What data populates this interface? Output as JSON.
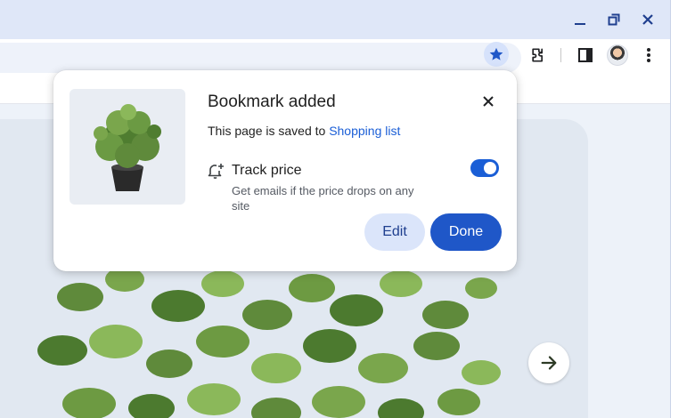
{
  "window": {
    "controls": {
      "minimize_icon": "minimize-icon",
      "restore_icon": "restore-icon",
      "close_icon": "close-icon"
    }
  },
  "toolbar": {
    "bookmark_star": {
      "state": "bookmarked",
      "icon": "star-icon"
    },
    "icons": [
      "extensions-icon",
      "side-panel-icon",
      "profile-avatar",
      "more-menu-icon"
    ]
  },
  "bubble": {
    "title": "Bookmark added",
    "saved_prefix": "This page is saved to ",
    "saved_folder": "Shopping list",
    "track": {
      "title": "Track price",
      "description": "Get emails if the price drops on any site",
      "enabled": true
    },
    "edit_label": "Edit",
    "done_label": "Done"
  },
  "page": {
    "next_icon": "arrow-right-icon"
  },
  "colors": {
    "chrome_bg": "#dfe7f8",
    "accent": "#1a5ed6",
    "done_button": "#1f57c8",
    "edit_button": "#dbe5fa"
  }
}
